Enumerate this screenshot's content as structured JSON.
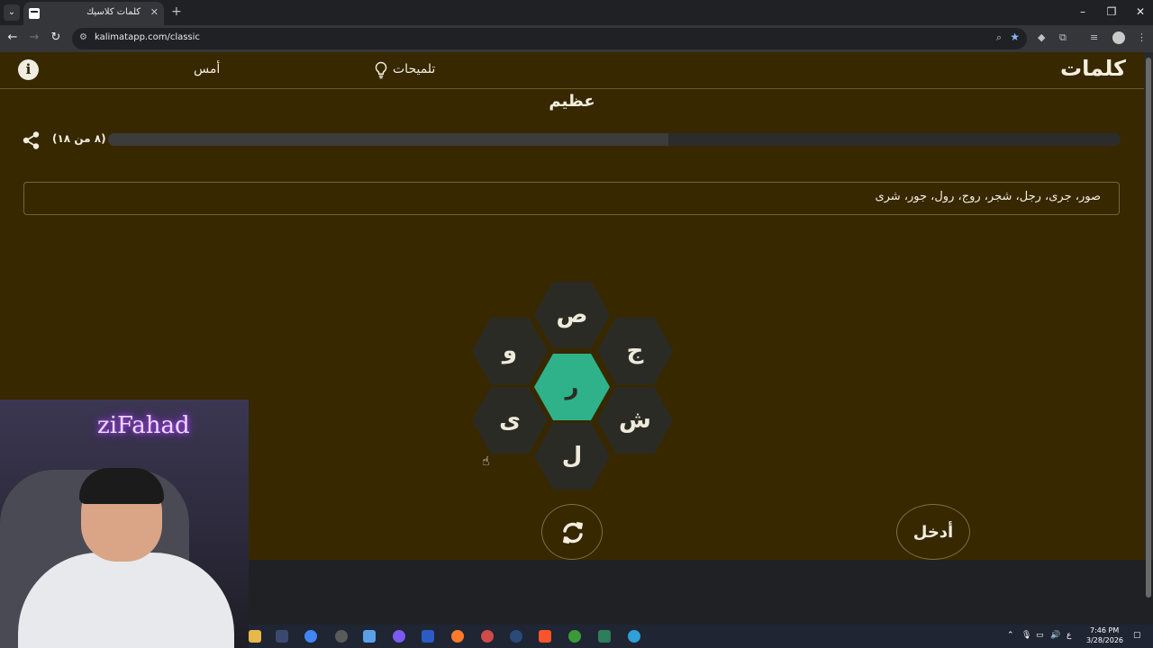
{
  "browser": {
    "tab_title": "كلمات كلاسيك",
    "url": "kalimatapp.com/classic"
  },
  "app": {
    "logo": "كلمات",
    "hints_label": "تلميحات",
    "yesterday_label": "أمس",
    "info_symbol": "i"
  },
  "game": {
    "rank": "عظيم",
    "progress_label": "(٨ من ١٨)",
    "progress_fraction": 0.553,
    "found_words": "صور، جرى، رجل، شجر، روج، رول، جور، شرى",
    "center_letter": "ر",
    "outer_letters": {
      "top": "ص",
      "upper_right": "ج",
      "lower_right": "ش",
      "bottom": "ل",
      "lower_left": "ى",
      "upper_left": "و"
    },
    "enter_label": "أدخل",
    "colors": {
      "background": "#372800",
      "center_hex": "#2fb28a",
      "outer_hex": "#2b2b26"
    }
  },
  "overlay": {
    "neon_sign": "ziFahad"
  },
  "taskbar": {
    "time": "7:46 PM",
    "date": "3/28/2026",
    "language": "ع"
  }
}
